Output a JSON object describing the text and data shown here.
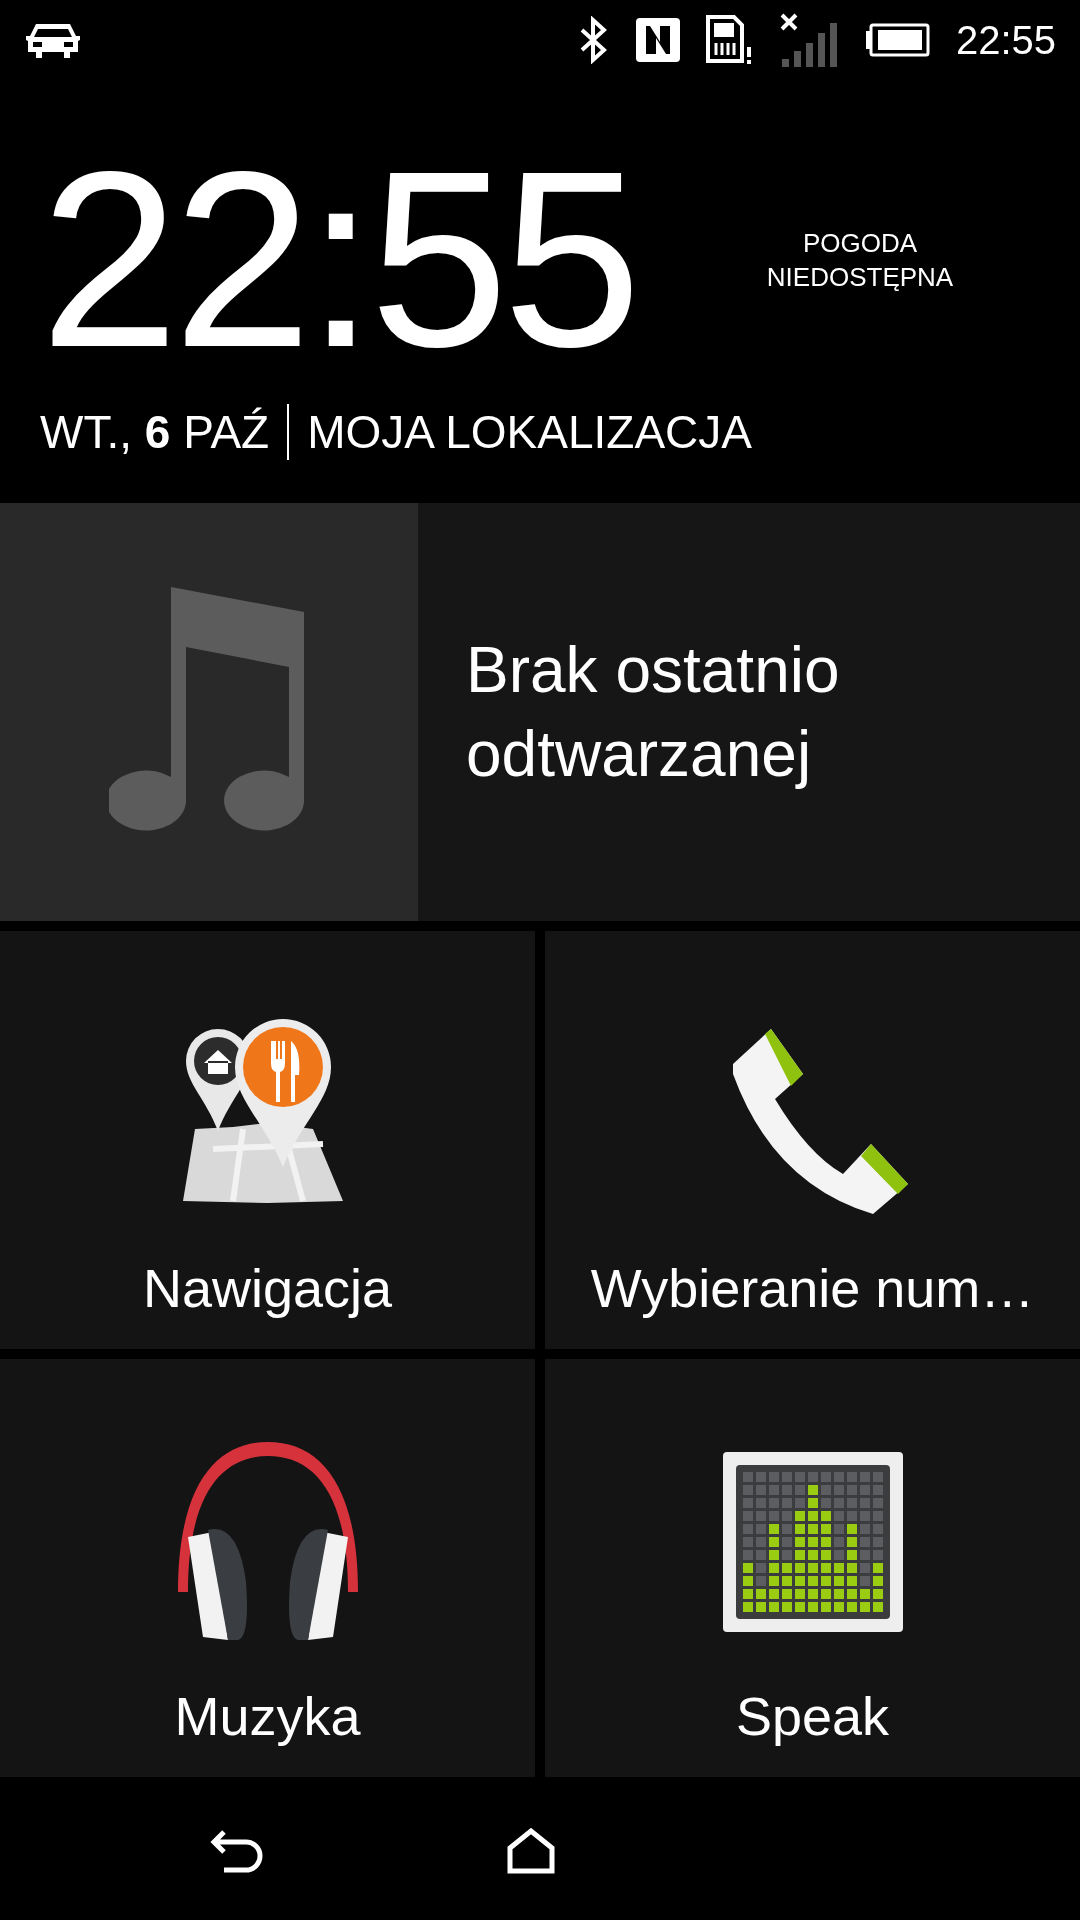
{
  "status_bar": {
    "time": "22:55"
  },
  "clock": {
    "time": "22:55",
    "weather": "POGODA NIEDOSTĘPNA",
    "date": "WT., **6** PAŹ",
    "location": "MOJA LOKALIZACJA"
  },
  "now_playing": {
    "text": "Brak ostatnio odtwarzanej"
  },
  "tiles": [
    {
      "kind": "navigation",
      "label": "Nawigacja"
    },
    {
      "kind": "phone",
      "label": "Wybieranie num…"
    },
    {
      "kind": "music",
      "label": "Muzyka"
    },
    {
      "kind": "speak",
      "label": "Speak"
    }
  ]
}
